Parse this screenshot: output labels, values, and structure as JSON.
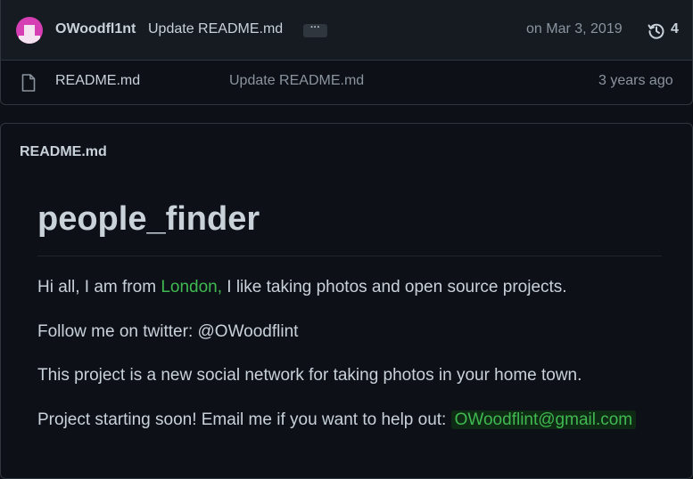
{
  "commit": {
    "author": "OWoodfl1nt",
    "message": "Update README.md",
    "ellipsis": "···",
    "date": "on Mar 3, 2019",
    "history_count": "4",
    "avatar_icon": "identicon-avatar",
    "history_icon": "history-icon"
  },
  "file": {
    "name": "README.md",
    "last_commit": "Update README.md",
    "age": "3 years ago",
    "icon": "file-icon"
  },
  "readme": {
    "title": "README.md",
    "heading": "people_finder",
    "p1_before": "Hi all, I am from ",
    "p1_link": "London,",
    "p1_after": " I like taking photos and open source projects.",
    "p2": "Follow me on twitter: @OWoodflint",
    "p3": "This project is a new social network for taking photos in your home town.",
    "p4_before": "Project starting soon! Email me if you want to help out: ",
    "p4_email": "OWoodflint@gmail.com"
  },
  "colors": {
    "background": "#0d1117",
    "header_bg": "#161b22",
    "text": "#c9d1d9",
    "muted": "#8b949e",
    "highlight": "#3fb950",
    "avatar": "#d63fb4"
  }
}
